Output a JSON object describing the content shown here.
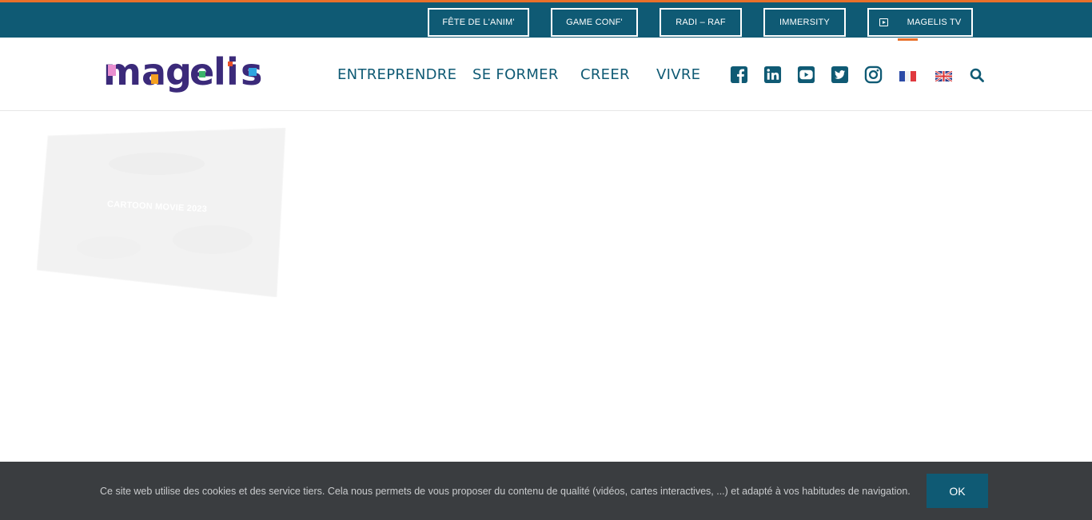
{
  "topbar": {
    "buttons": [
      {
        "label": "FÊTE DE L'ANIM'"
      },
      {
        "label": "GAME CONF'"
      },
      {
        "label": "RADI – RAF"
      },
      {
        "label": "IMMERSITY"
      },
      {
        "label": "MAGELIS TV",
        "icon": "play-box-icon"
      }
    ],
    "accent_color": "#e8702a",
    "background_color": "#0f5a74"
  },
  "header": {
    "logo_text": "Magelis",
    "nav": [
      {
        "label": "ENTREPRENDRE"
      },
      {
        "label": "SE FORMER"
      },
      {
        "label": "CREER"
      },
      {
        "label": "VIVRE"
      }
    ],
    "social_icons": [
      "facebook-icon",
      "linkedin-icon",
      "youtube-icon",
      "twitter-icon",
      "instagram-icon"
    ],
    "languages": [
      "fr-flag-icon",
      "uk-flag-icon"
    ],
    "search_icon": "search-icon"
  },
  "main": {
    "card_title": "CARTOON MOVIE 2023"
  },
  "cookie_bar": {
    "text": "Ce site web utilise des cookies et des service tiers. Cela nous permets de vous proposer du contenu de qualité (vidéos, cartes interactives, ...) et adapté à vos habitudes de navigation.",
    "ok_label": "OK"
  }
}
